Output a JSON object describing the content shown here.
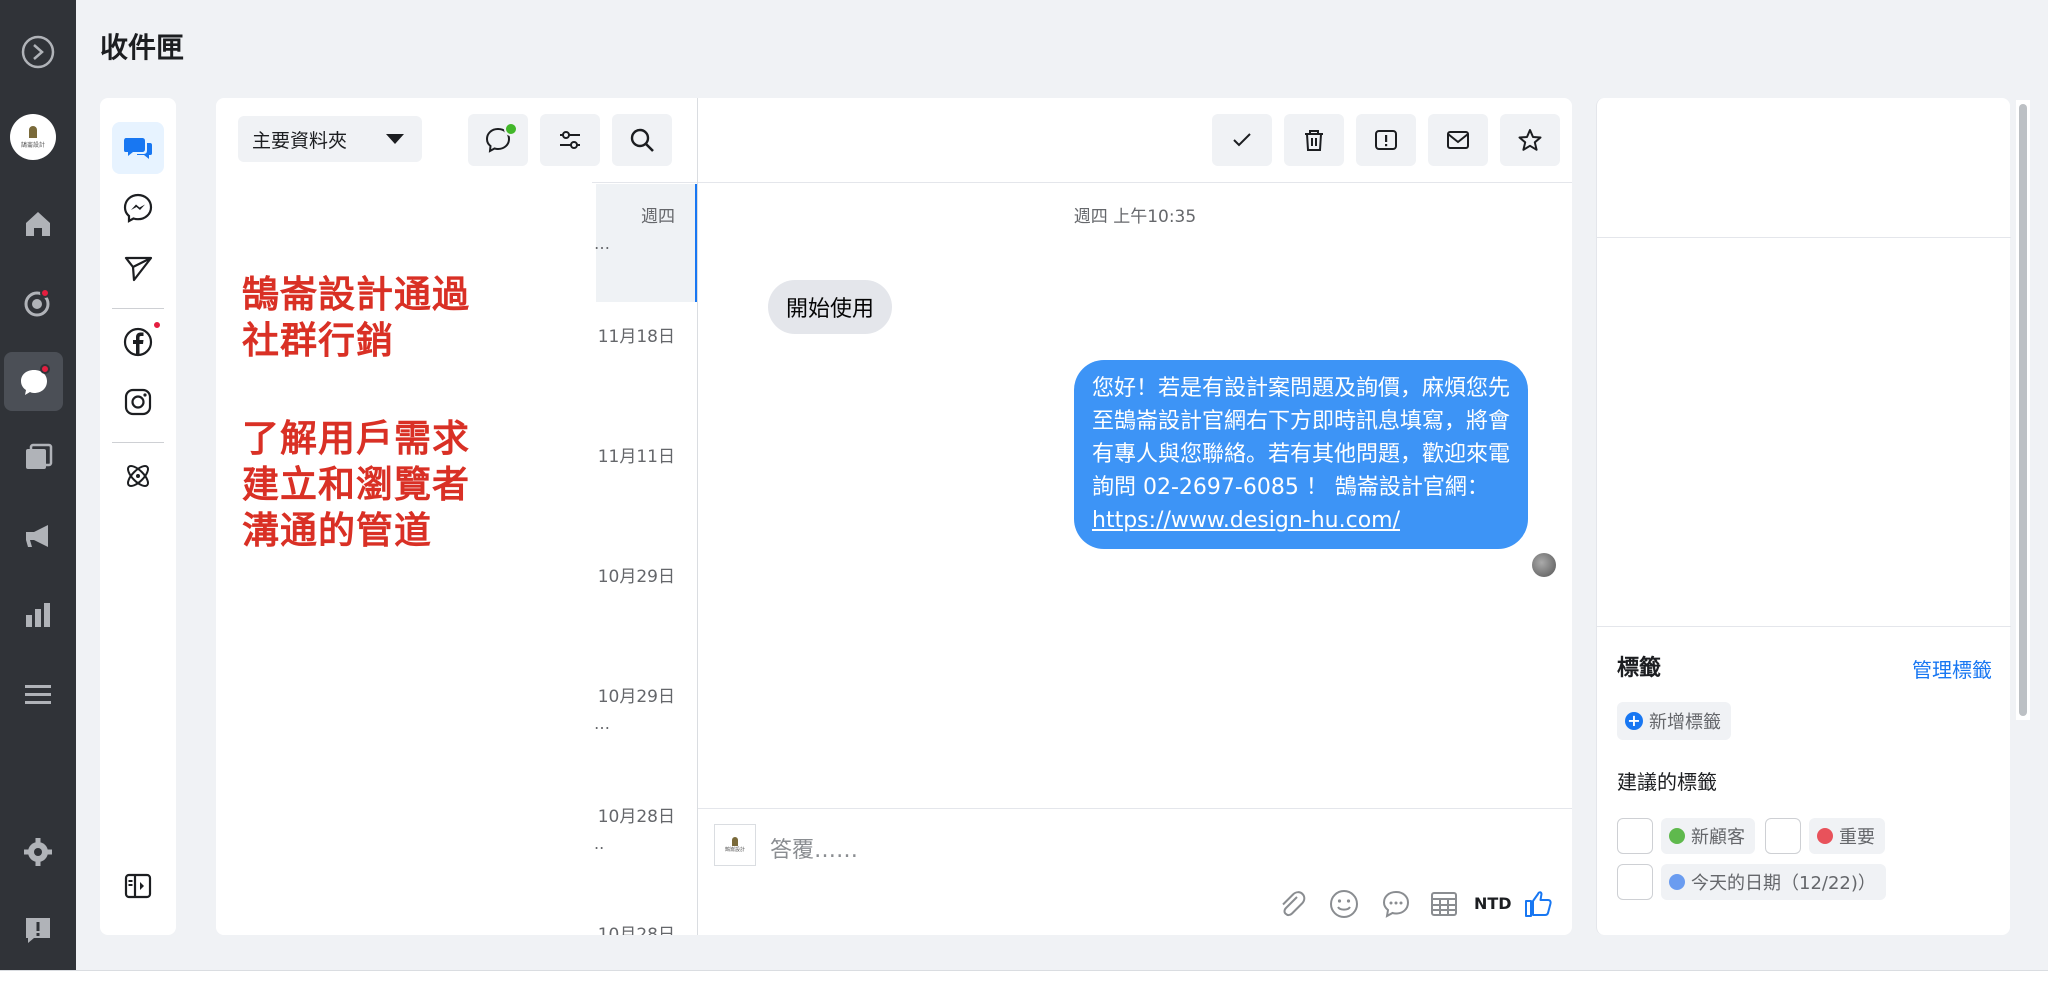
{
  "page": {
    "title": "收件匣"
  },
  "rail": {
    "items": [
      {
        "name": "meta-logo-icon"
      },
      {
        "name": "page-avatar",
        "avatar_text": "鵠崙設計"
      },
      {
        "name": "home-icon"
      },
      {
        "name": "activity-icon",
        "badge": true
      },
      {
        "name": "inbox-icon",
        "badge": true,
        "active": true
      },
      {
        "name": "content-icon"
      },
      {
        "name": "ads-megaphone-icon"
      },
      {
        "name": "insights-icon"
      },
      {
        "name": "menu-icon"
      },
      {
        "name": "settings-icon"
      },
      {
        "name": "feedback-icon"
      }
    ]
  },
  "channels": [
    {
      "name": "all-messages-icon",
      "active": true
    },
    {
      "name": "messenger-icon"
    },
    {
      "name": "send-icon"
    },
    {
      "name": "facebook-icon",
      "badge": true
    },
    {
      "name": "instagram-icon"
    },
    {
      "name": "automation-icon"
    },
    {
      "name": "collapse-panel-icon"
    }
  ],
  "convlist": {
    "folder_label": "主要資料夾",
    "rows": [
      {
        "date": "週四",
        "snippet": "…"
      },
      {
        "date": "11月18日",
        "snippet": ""
      },
      {
        "date": "11月11日",
        "snippet": ""
      },
      {
        "date": "10月29日",
        "snippet": ""
      },
      {
        "date": "10月29日",
        "snippet": "…"
      },
      {
        "date": "10月28日",
        "snippet": ".."
      },
      {
        "date": "10月28日",
        "snippet": ""
      }
    ],
    "overlay_lines": [
      "鵠崙設計通過",
      "社群行銷",
      "了解用戶需求",
      "建立和瀏覽者",
      "溝通的管道"
    ]
  },
  "thread": {
    "timestamp": "週四 上午10:35",
    "incoming": "開始使用",
    "outgoing_text": "您好！若是有設計案問題及詢價，麻煩您先至鵠崙設計官網右下方即時訊息填寫，將會有專人與您聯絡。若有其他問題，歡迎來電詢問 02-2697-6085 ！ 鵠崙設計官網：",
    "outgoing_link": "https://www.design-hu.com/",
    "composer_placeholder": "答覆……",
    "composer_logo_text": "鵠崙設計",
    "ntd_label": "NTD"
  },
  "info": {
    "tags_title": "標籤",
    "manage_label": "管理標籤",
    "add_tag_label": "新增標籤",
    "suggested_title": "建議的標籤",
    "suggested": [
      {
        "label": "新顧客",
        "color": "#5fb94d"
      },
      {
        "label": "重要",
        "color": "#e8525b"
      },
      {
        "label": "今天的日期（12/22)）",
        "color": "#6a9cf0"
      }
    ]
  },
  "colors": {
    "accent": "#1877f2",
    "rail_bg": "#303338",
    "bubble_out": "#3d94f6",
    "overlay_text": "#d93025"
  }
}
